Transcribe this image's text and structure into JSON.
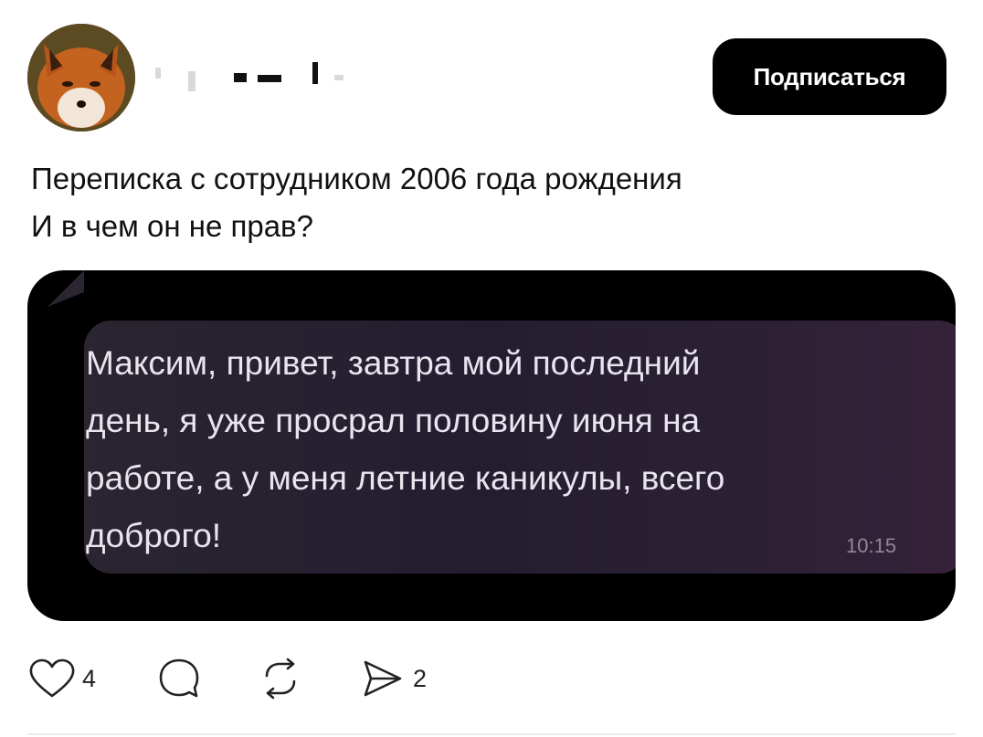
{
  "header": {
    "subscribe_label": "Подписаться"
  },
  "post": {
    "text_lines": [
      "Переписка с сотрудником 2006 года рождения",
      "И в чем он не прав?"
    ]
  },
  "media": {
    "message_lines": [
      "Максим, привет, завтра мой последний",
      "день, я уже просрал половину июня на",
      "работе, а у меня летние каникулы, всего",
      "доброго!"
    ],
    "time": "10:15"
  },
  "actions": {
    "likes_count": "4",
    "shares_count": "2"
  },
  "colors": {
    "subscribe_bg": "#000000",
    "media_bg": "#000000",
    "bubble_bg": "#2a2530"
  }
}
